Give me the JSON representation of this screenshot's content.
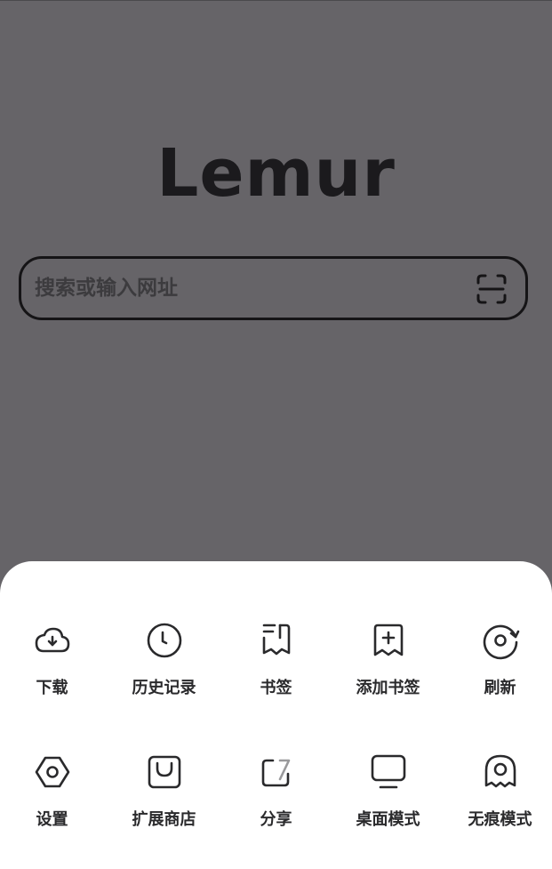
{
  "app": {
    "logo_text": "Lemur"
  },
  "search": {
    "placeholder": "搜索或输入网址",
    "scan_icon": "scan-icon"
  },
  "menu": {
    "items": [
      {
        "label": "下载",
        "icon": "download-cloud-icon"
      },
      {
        "label": "历史记录",
        "icon": "clock-icon"
      },
      {
        "label": "书签",
        "icon": "bookmark-list-icon"
      },
      {
        "label": "添加书签",
        "icon": "add-bookmark-icon"
      },
      {
        "label": "刷新",
        "icon": "refresh-icon"
      },
      {
        "label": "设置",
        "icon": "settings-icon"
      },
      {
        "label": "扩展商店",
        "icon": "shopping-bag-icon"
      },
      {
        "label": "分享",
        "icon": "share-icon"
      },
      {
        "label": "桌面模式",
        "icon": "desktop-monitor-icon"
      },
      {
        "label": "无痕模式",
        "icon": "incognito-ghost-icon"
      }
    ]
  },
  "colors": {
    "background_dim": "#666468",
    "sheet": "#ffffff",
    "icon_stroke": "#2a2a2c"
  }
}
